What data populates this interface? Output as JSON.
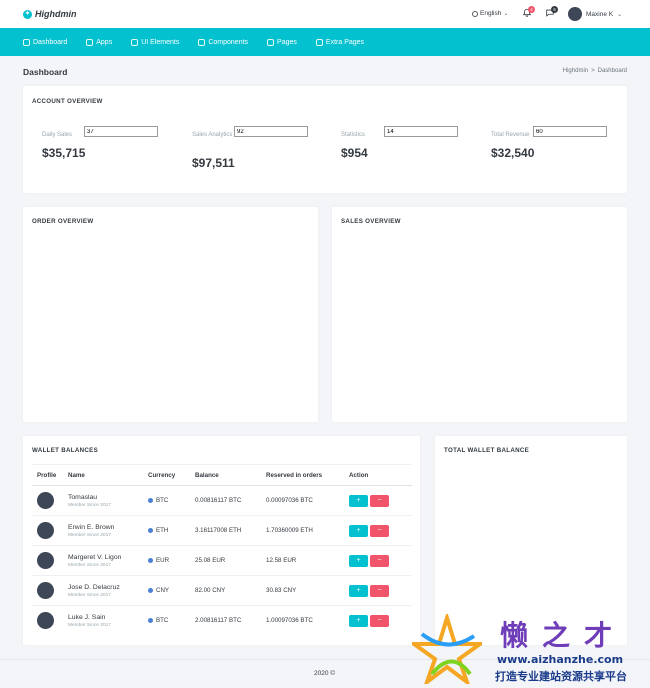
{
  "brand": {
    "name": "Highdmin"
  },
  "topbar": {
    "language": "English",
    "notifications_count": "4",
    "messages_count": "6",
    "user_name": "Maxine K"
  },
  "nav": {
    "items": [
      {
        "label": "Dashboard",
        "icon": "dashboard-icon"
      },
      {
        "label": "Apps",
        "icon": "apps-icon"
      },
      {
        "label": "UI Elements",
        "icon": "ui-elements-icon"
      },
      {
        "label": "Components",
        "icon": "components-icon"
      },
      {
        "label": "Pages",
        "icon": "pages-icon"
      },
      {
        "label": "Extra Pages",
        "icon": "extra-pages-icon"
      }
    ]
  },
  "page": {
    "title": "Dashboard",
    "breadcrumb": [
      "Highdmin",
      ">",
      "Dashboard"
    ]
  },
  "account_overview": {
    "title": "ACCOUNT OVERVIEW",
    "stats": [
      {
        "label": "Daily Sales",
        "input_value": "37",
        "value": "$35,715"
      },
      {
        "label": "Sales Analytics",
        "input_value": "92",
        "value": "$97,511"
      },
      {
        "label": "Statistics",
        "input_value": "14",
        "value": "$954"
      },
      {
        "label": "Total Revenue",
        "input_value": "60",
        "value": "$32,540"
      }
    ]
  },
  "order_overview": {
    "title": "ORDER OVERVIEW"
  },
  "sales_overview": {
    "title": "SALES OVERVIEW"
  },
  "wallet": {
    "title": "WALLET BALANCES",
    "columns": [
      "Profile",
      "Name",
      "Currency",
      "Balance",
      "Reserved in orders",
      "Action"
    ],
    "rows": [
      {
        "name": "Tomaslau",
        "since": "Member Since 2017",
        "currency": "BTC",
        "balance": "0.00816117 BTC",
        "reserved": "0.00097036 BTC"
      },
      {
        "name": "Erwin E. Brown",
        "since": "Member Since 2017",
        "currency": "ETH",
        "balance": "3.16117008 ETH",
        "reserved": "1.70360009 ETH"
      },
      {
        "name": "Margeret V. Ligon",
        "since": "Member Since 2017",
        "currency": "EUR",
        "balance": "25.08 EUR",
        "reserved": "12.58 EUR"
      },
      {
        "name": "Jose D. Delacruz",
        "since": "Member Since 2017",
        "currency": "CNY",
        "balance": "82.00 CNY",
        "reserved": "30.83 CNY"
      },
      {
        "name": "Luke J. Sain",
        "since": "Member Since 2017",
        "currency": "BTC",
        "balance": "2.00816117 BTC",
        "reserved": "1.00097036 BTC"
      }
    ],
    "plus_label": "+",
    "minus_label": "−"
  },
  "total_wallet": {
    "title": "TOTAL WALLET BALANCE"
  },
  "footer": {
    "text": "2020 ©"
  },
  "watermark": {
    "cn_title": "懒之才",
    "url": "www.aizhanzhe.com",
    "cn_slogan": "打造专业建站资源共享平台"
  },
  "colors": {
    "accent": "#03c1ce",
    "danger": "#f1556c",
    "dark": "#343a40"
  }
}
